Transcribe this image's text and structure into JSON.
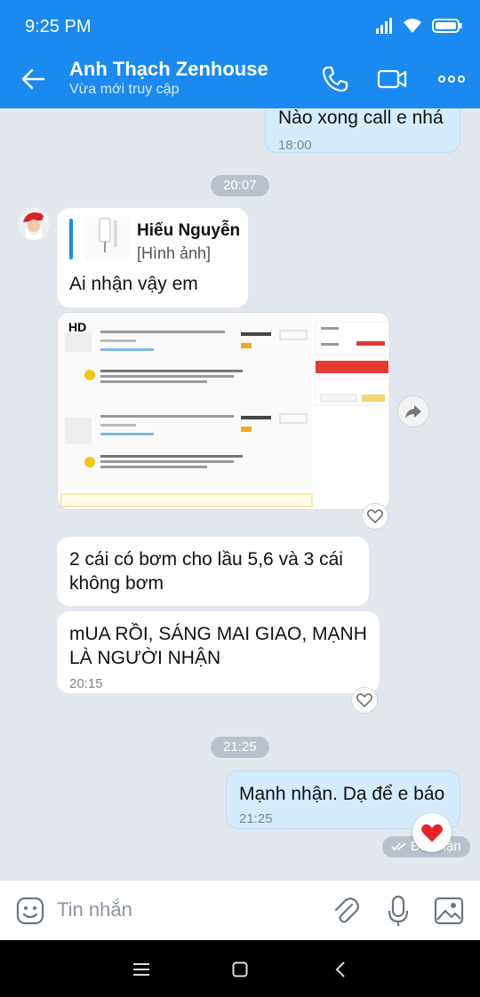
{
  "status_bar": {
    "time": "9:25 PM"
  },
  "header": {
    "title": "Anh Thạch Zenhouse",
    "subtitle": "Vừa mới truy cập"
  },
  "messages": {
    "m0": {
      "text": "Nào xong call e nhá",
      "time": "18:00"
    },
    "chip1": "20:07",
    "reply": {
      "name": "Hiếu Nguyễn",
      "type": "[Hình ảnh]",
      "text": "Ai nhận vậy em"
    },
    "image": {
      "badge": "HD"
    },
    "m2": {
      "text": "2 cái có bơm cho lầu 5,6 và 3 cái không bơm"
    },
    "m3": {
      "text": "mUA RỒI, SÁNG MAI GIAO, MẠNH LÀ NGƯỜI NHẬN",
      "time": "20:15"
    },
    "chip2": "21:25",
    "m4": {
      "text": "Mạnh nhận. Dạ để e báo",
      "time": "21:25",
      "status": "Đã nhận"
    }
  },
  "input": {
    "placeholder": "Tin nhắn"
  },
  "colors": {
    "primary": "#1a8af0",
    "chat_bg": "#e3e8ef",
    "mine_bubble": "#d5ecfd",
    "reaction": "#e8202a"
  }
}
